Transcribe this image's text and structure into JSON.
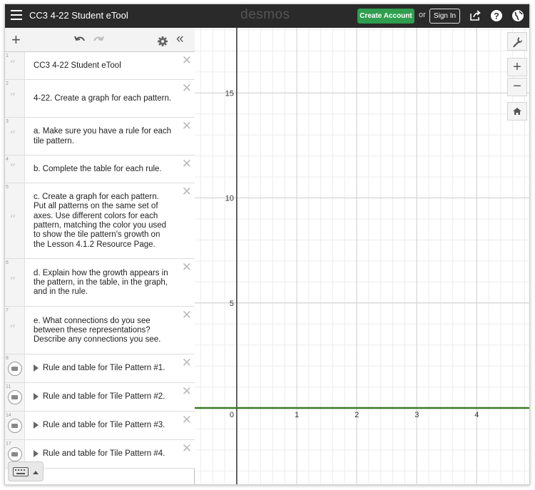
{
  "header": {
    "title": "CC3 4-22 Student eTool",
    "logo": "desmos",
    "create_account": "Create Account",
    "or": "or",
    "sign_in": "Sign In"
  },
  "expressions": [
    {
      "num": "1",
      "text": "CC3 4-22 Student eTool"
    },
    {
      "num": "2",
      "text": "4-22. Create a graph for each pattern."
    },
    {
      "num": "3",
      "text": "a. Make sure you have a rule for each tile pattern."
    },
    {
      "num": "4",
      "text": "b. Complete the table for each rule."
    },
    {
      "num": "5",
      "text": "c. Create a graph for each pattern. Put all patterns on the same set of axes. Use different colors for each pattern, matching the color you used to show the tile pattern's growth on the Lesson 4.1.2 Resource Page."
    },
    {
      "num": "6",
      "text": "d. Explain how the growth appears in the pattern, in the table, in the graph, and in the rule."
    },
    {
      "num": "7",
      "text": "e. What connections do you see between these representations? Describe any connections you see."
    }
  ],
  "folders": [
    {
      "num": "8",
      "text": "Rule and table for Tile Pattern #1."
    },
    {
      "num": "11",
      "text": "Rule and table for Tile Pattern #2."
    },
    {
      "num": "14",
      "text": "Rule and table for Tile Pattern #3."
    },
    {
      "num": "17",
      "text": "Rule and table for Tile Pattern #4."
    }
  ],
  "graph": {
    "x_ticks": [
      "0",
      "1",
      "2",
      "3",
      "4"
    ],
    "y_ticks": [
      "5",
      "10",
      "15"
    ],
    "x_range": [
      -0.7,
      4.9
    ],
    "y_range": [
      -3.7,
      18.1
    ],
    "line_y": 0,
    "line_color": "#3a7a22"
  },
  "colors": {
    "accent": "#2f9e4e",
    "header_bg": "#2a2a2a"
  }
}
